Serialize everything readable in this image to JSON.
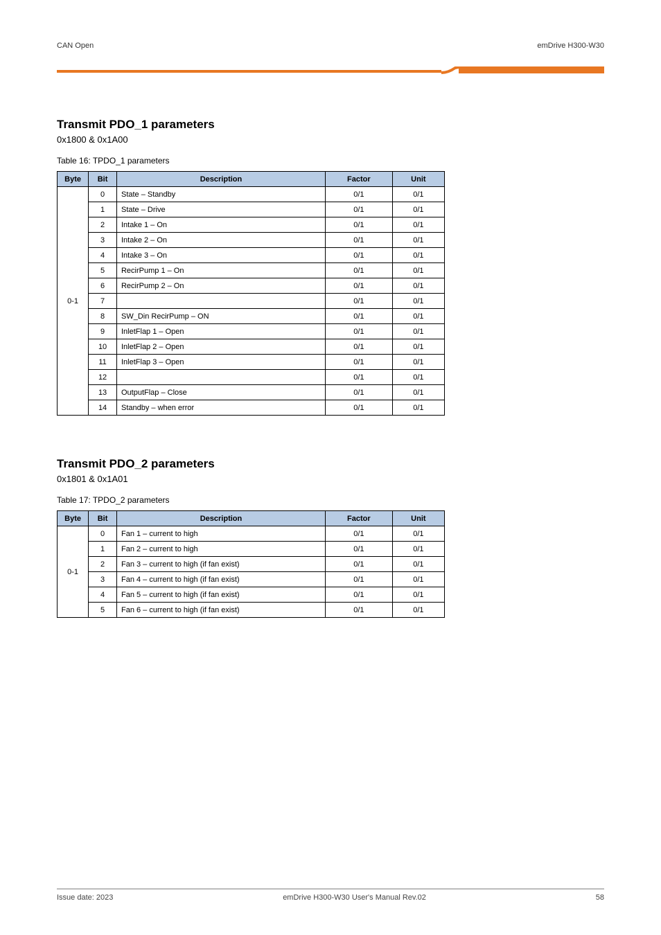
{
  "header": {
    "left": "CAN Open",
    "right": "emDrive H300-W30"
  },
  "section1": {
    "heading": "Transmit PDO_1 parameters",
    "subheading": "0x1800 & 0x1A00",
    "caption": "Table 16: TPDO_1 parameters",
    "columns": [
      "Byte",
      "Bit",
      "Description",
      "Factor",
      "Unit"
    ],
    "group_label": "0-1",
    "rows": [
      {
        "bit": "0",
        "desc": "State – Standby",
        "factor": "0/1",
        "unit": "0/1"
      },
      {
        "bit": "1",
        "desc": "State – Drive",
        "factor": "0/1",
        "unit": "0/1"
      },
      {
        "bit": "2",
        "desc": "Intake 1 – On",
        "factor": "0/1",
        "unit": "0/1"
      },
      {
        "bit": "3",
        "desc": "Intake 2 – On",
        "factor": "0/1",
        "unit": "0/1"
      },
      {
        "bit": "4",
        "desc": "Intake 3 – On",
        "factor": "0/1",
        "unit": "0/1"
      },
      {
        "bit": "5",
        "desc": "RecirPump 1 – On",
        "factor": "0/1",
        "unit": "0/1"
      },
      {
        "bit": "6",
        "desc": "RecirPump 2 – On",
        "factor": "0/1",
        "unit": "0/1"
      },
      {
        "bit": "7",
        "desc": "",
        "factor": "0/1",
        "unit": "0/1"
      },
      {
        "bit": "8",
        "desc": "SW_Din RecirPump – ON",
        "factor": "0/1",
        "unit": "0/1"
      },
      {
        "bit": "9",
        "desc": "InletFlap 1 – Open",
        "factor": "0/1",
        "unit": "0/1"
      },
      {
        "bit": "10",
        "desc": "InletFlap 2 – Open",
        "factor": "0/1",
        "unit": "0/1"
      },
      {
        "bit": "11",
        "desc": "InletFlap 3 – Open",
        "factor": "0/1",
        "unit": "0/1"
      },
      {
        "bit": "12",
        "desc": "",
        "factor": "0/1",
        "unit": "0/1"
      },
      {
        "bit": "13",
        "desc": "OutputFlap – Close",
        "factor": "0/1",
        "unit": "0/1"
      },
      {
        "bit": "14",
        "desc": "Standby – when error",
        "factor": "0/1",
        "unit": "0/1"
      }
    ]
  },
  "section2": {
    "heading": "Transmit PDO_2 parameters",
    "subheading": "0x1801 & 0x1A01",
    "caption": "Table 17: TPDO_2 parameters",
    "columns": [
      "Byte",
      "Bit",
      "Description",
      "Factor",
      "Unit"
    ],
    "group_label": "0-1",
    "rows": [
      {
        "bit": "0",
        "desc": "Fan 1 – current to high",
        "factor": "0/1",
        "unit": "0/1"
      },
      {
        "bit": "1",
        "desc": "Fan 2 – current to high",
        "factor": "0/1",
        "unit": "0/1"
      },
      {
        "bit": "2",
        "desc": "Fan 3 – current to high (if fan exist)",
        "factor": "0/1",
        "unit": "0/1"
      },
      {
        "bit": "3",
        "desc": "Fan 4 – current to high (if fan exist)",
        "factor": "0/1",
        "unit": "0/1"
      },
      {
        "bit": "4",
        "desc": "Fan 5 – current to high (if fan exist)",
        "factor": "0/1",
        "unit": "0/1"
      },
      {
        "bit": "5",
        "desc": "Fan 6 – current to high (if fan exist)",
        "factor": "0/1",
        "unit": "0/1"
      }
    ]
  },
  "footer": {
    "left": "Issue date: 2023",
    "center": "emDrive H300-W30 User's Manual Rev.02",
    "right": "58"
  }
}
